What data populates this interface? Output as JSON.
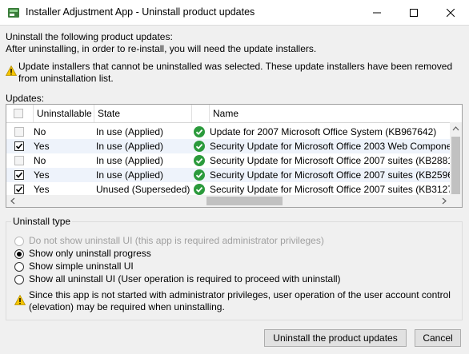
{
  "window": {
    "title": "Installer Adjustment App - Uninstall product updates"
  },
  "intro": {
    "line1": "Uninstall the following product updates:",
    "line2": "After uninstalling, in order to re-install, you will need the update installers."
  },
  "warning": {
    "line1": "Update installers that cannot be uninstalled was selected. These update installers have been removed",
    "line2": "from uninstallation list."
  },
  "updates_label": "Updates:",
  "grid": {
    "columns": [
      "Uninstallable",
      "State",
      "Name"
    ],
    "rows": [
      {
        "checked": false,
        "disabled": true,
        "uninstallable": "No",
        "state": "In use (Applied)",
        "name": "Update for 2007 Microsoft Office System (KB967642)"
      },
      {
        "checked": true,
        "disabled": false,
        "uninstallable": "Yes",
        "state": "In use (Applied)",
        "name": "Security Update for Microsoft Office 2003 Web Compone"
      },
      {
        "checked": false,
        "disabled": true,
        "uninstallable": "No",
        "state": "In use (Applied)",
        "name": "Security Update for Microsoft Office 2007 suites (KB2881"
      },
      {
        "checked": true,
        "disabled": false,
        "uninstallable": "Yes",
        "state": "In use (Applied)",
        "name": "Security Update for Microsoft Office 2007 suites (KB2596"
      },
      {
        "checked": true,
        "disabled": false,
        "uninstallable": "Yes",
        "state": "Unused (Superseded)",
        "name": "Security Update for Microsoft Office 2007 suites (KB3127"
      }
    ]
  },
  "uninstall_type": {
    "label": "Uninstall type",
    "options": [
      {
        "label": "Do not show uninstall UI (this app is required administrator privileges)",
        "selected": false,
        "disabled": true
      },
      {
        "label": "Show only uninstall progress",
        "selected": true,
        "disabled": false
      },
      {
        "label": "Show simple uninstall UI",
        "selected": false,
        "disabled": false
      },
      {
        "label": "Show all uninstall UI (User operation is required to proceed with uninstall)",
        "selected": false,
        "disabled": false
      }
    ],
    "note_line1": "Since this app is not started with administrator privileges, user operation of the user account control",
    "note_line2": "(elevation) may be required when uninstalling."
  },
  "buttons": {
    "uninstall": "Uninstall the product updates",
    "cancel": "Cancel"
  },
  "icons": {
    "app": "installer-app-icon",
    "warning": "warning-icon",
    "status": "check-circle-icon"
  },
  "colors": {
    "status_green": "#2b9a3c",
    "warning_yellow": "#f5c400"
  }
}
